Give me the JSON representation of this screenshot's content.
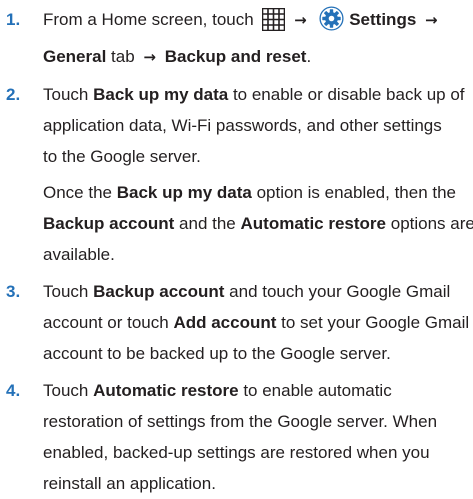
{
  "steps": [
    {
      "number": "1.",
      "home_lead": "From a Home screen, touch",
      "apps_icon": "apps-grid-icon",
      "settings_icon": "settings-gear-icon",
      "arrow": "→",
      "settings": "Settings",
      "general": "General",
      "tab_text": "tab",
      "backup_and_reset": "Backup and reset",
      "period": "."
    },
    {
      "number": "2.",
      "touch": "Touch",
      "back_up_my_data": "Back up my data",
      "line1_rest": "to enable or disable back up of",
      "line2": "application data, Wi-Fi passwords, and other settings",
      "line3": "to the Google server.",
      "once_the": "Once the",
      "back_up_my_data_2": "Back up my data",
      "option_enabled": "option is enabled, then the",
      "backup_account": "Backup account",
      "and_the": "and the",
      "automatic_restore": "Automatic restore",
      "options_are": "options are",
      "available": "available."
    },
    {
      "number": "3.",
      "touch": "Touch",
      "backup_account": "Backup account",
      "line1_rest": "and touch your Google Gmail",
      "line2_a": "account or touch",
      "add_account": "Add account",
      "line2_b": "to set your Google Gmail",
      "line3": "account to be backed up to the Google server."
    },
    {
      "number": "4.",
      "touch": "Touch",
      "automatic_restore": "Automatic restore",
      "line1_rest": "to enable automatic",
      "line2": "restoration of settings from the Google server. When",
      "line3": "enabled, backed-up settings are restored when you",
      "line4": "reinstall an application."
    }
  ]
}
